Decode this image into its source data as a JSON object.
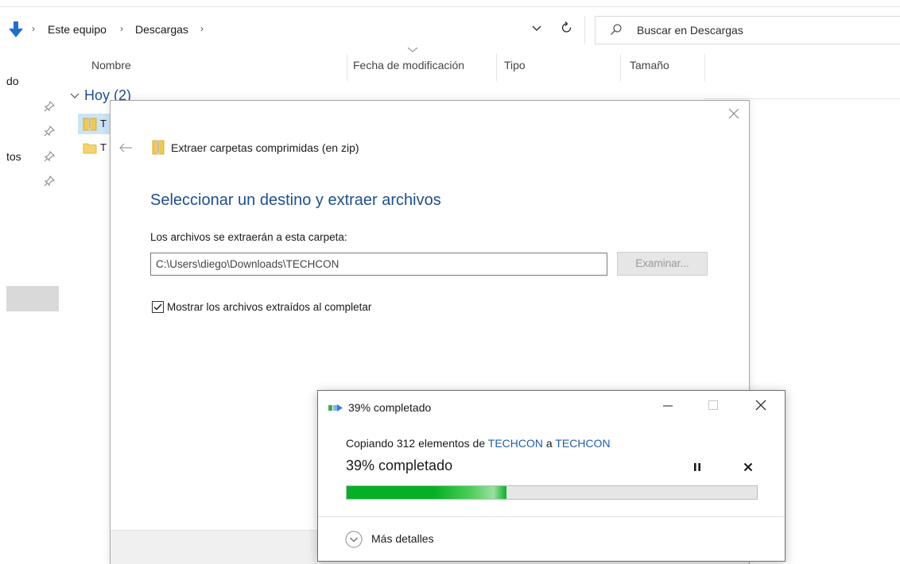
{
  "explorer": {
    "breadcrumb": [
      "Este equipo",
      "Descargas"
    ],
    "search_placeholder": "Buscar en Descargas",
    "columns": {
      "name": "Nombre",
      "modified": "Fecha de modificación",
      "type": "Tipo",
      "size": "Tamaño"
    },
    "nav_partial": [
      "do",
      "tos"
    ],
    "group_label": "Hoy (2)",
    "files": [
      {
        "name_partial": "T",
        "icon": "zip-folder-icon"
      },
      {
        "name_partial": "T",
        "icon": "folder-icon"
      }
    ]
  },
  "extract_dialog": {
    "title": "Extraer carpetas comprimidas (en zip)",
    "heading": "Seleccionar un destino y extraer archivos",
    "folder_label": "Los archivos se extraerán a esta carpeta:",
    "path_value": "C:\\Users\\diego\\Downloads\\TECHCON",
    "browse_label": "Examinar...",
    "show_files_label": "Mostrar los archivos extraídos al completar",
    "show_files_checked": true
  },
  "progress_dialog": {
    "title": "39% completado",
    "copying_prefix": "Copiando 312 elementos de ",
    "source": "TECHCON",
    "connector": " a ",
    "destination": "TECHCON",
    "percent_text": "39% completado",
    "progress_fraction": 0.39,
    "details_label": "Más detalles"
  },
  "colors": {
    "accent_blue": "#1d4f91",
    "link_blue": "#1f5fae",
    "progress_green": "#06b025",
    "selection": "#cce4f7"
  }
}
